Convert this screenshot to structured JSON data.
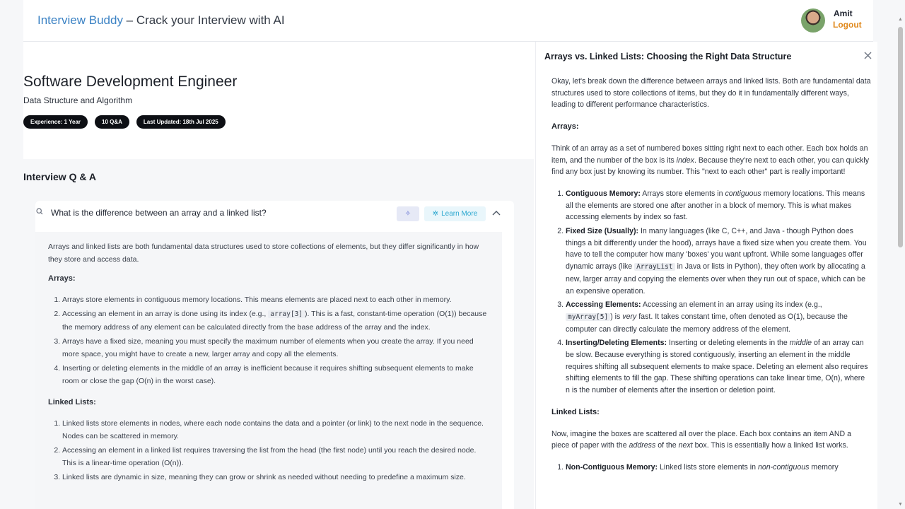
{
  "header": {
    "brand_name": "Interview Buddy",
    "brand_tagline": " – Crack your Interview with AI",
    "user_name": "Amit",
    "logout_label": "Logout"
  },
  "job": {
    "title": "Software Development Engineer",
    "subtitle": "Data Structure and Algorithm",
    "chips": [
      "Experience: 1 Year",
      "10 Q&A",
      "Last Updated: 18th Jul 2025"
    ]
  },
  "qa_section": {
    "title": "Interview Q & A",
    "question": "What is the difference between an array and a linked list?",
    "learn_more_label": "Learn More",
    "answer": {
      "intro": "Arrays and linked lists are both fundamental data structures used to store collections of elements, but they differ significantly in how they store and access data.",
      "arrays_heading": "Arrays:",
      "arrays_points": [
        "Arrays store elements in contiguous memory locations. This means elements are placed next to each other in memory.",
        "Accessing an element in an array is done using its index (e.g., ",
        "Arrays have a fixed size, meaning you must specify the maximum number of elements when you create the array. If you need more space, you might have to create a new, larger array and copy all the elements.",
        "Inserting or deleting elements in the middle of an array is inefficient because it requires shifting subsequent elements to make room or close the gap (O(n) in the worst case)."
      ],
      "arrays_code": "array[3]",
      "arrays_point2_tail": "). This is a fast, constant-time operation (O(1)) because the memory address of any element can be calculated directly from the base address of the array and the index.",
      "linked_heading": "Linked Lists:",
      "linked_points": [
        "Linked lists store elements in nodes, where each node contains the data and a pointer (or link) to the next node in the sequence. Nodes can be scattered in memory.",
        "Accessing an element in a linked list requires traversing the list from the head (the first node) until you reach the desired node. This is a linear-time operation (O(n)).",
        "Linked lists are dynamic in size, meaning they can grow or shrink as needed without needing to predefine a maximum size."
      ]
    }
  },
  "panel": {
    "title": "Arrays vs. Linked Lists: Choosing the Right Data Structure",
    "intro": "Okay, let's break down the difference between arrays and linked lists. Both are fundamental data structures used to store collections of items, but they do it in fundamentally different ways, leading to different performance characteristics.",
    "arrays_heading": "Arrays:",
    "arrays_para_a": "Think of an array as a set of numbered boxes sitting right next to each other. Each box holds an item, and the number of the box is its ",
    "arrays_para_em": "index",
    "arrays_para_b": ". Because they're next to each other, you can quickly find any box just by knowing its number. This \"next to each other\" part is really important!",
    "p1_label": "Contiguous Memory:",
    "p1_a": " Arrays store elements in ",
    "p1_em": "contiguous",
    "p1_b": " memory locations. This means all the elements are stored one after another in a block of memory. This is what makes accessing elements by index so fast.",
    "p2_label": "Fixed Size (Usually):",
    "p2_a": " In many languages (like C, C++, and Java - though Python does things a bit differently under the hood), arrays have a fixed size when you create them. You have to tell the computer how many 'boxes' you want upfront. While some languages offer dynamic arrays (like ",
    "p2_code": "ArrayList",
    "p2_b": " in Java or lists in Python), they often work by allocating a new, larger array and copying the elements over when they run out of space, which can be an expensive operation.",
    "p3_label": "Accessing Elements:",
    "p3_a": " Accessing an element in an array using its index (e.g., ",
    "p3_code": "myArray[5]",
    "p3_b": ") is ",
    "p3_em": "very",
    "p3_c": " fast. It takes constant time, often denoted as O(1), because the computer can directly calculate the memory address of the element.",
    "p4_label": "Inserting/Deleting Elements:",
    "p4_a": " Inserting or deleting elements in the ",
    "p4_em": "middle",
    "p4_b": " of an array can be slow. Because everything is stored contiguously, inserting an element in the middle requires shifting all subsequent elements to make space. Deleting an element also requires shifting elements to fill the gap. These shifting operations can take linear time, O(n), where n is the number of elements after the insertion or deletion point.",
    "linked_heading": "Linked Lists:",
    "linked_para_a": "Now, imagine the boxes are scattered all over the place. Each box contains an item AND a piece of paper with the ",
    "linked_para_em1": "address",
    "linked_para_b": " of the ",
    "linked_para_em2": "next",
    "linked_para_c": " box. This is essentially how a linked list works.",
    "lp1_label": "Non-Contiguous Memory:",
    "lp1_a": " Linked lists store elements in ",
    "lp1_em": "non-contiguous",
    "lp1_b": " memory"
  }
}
